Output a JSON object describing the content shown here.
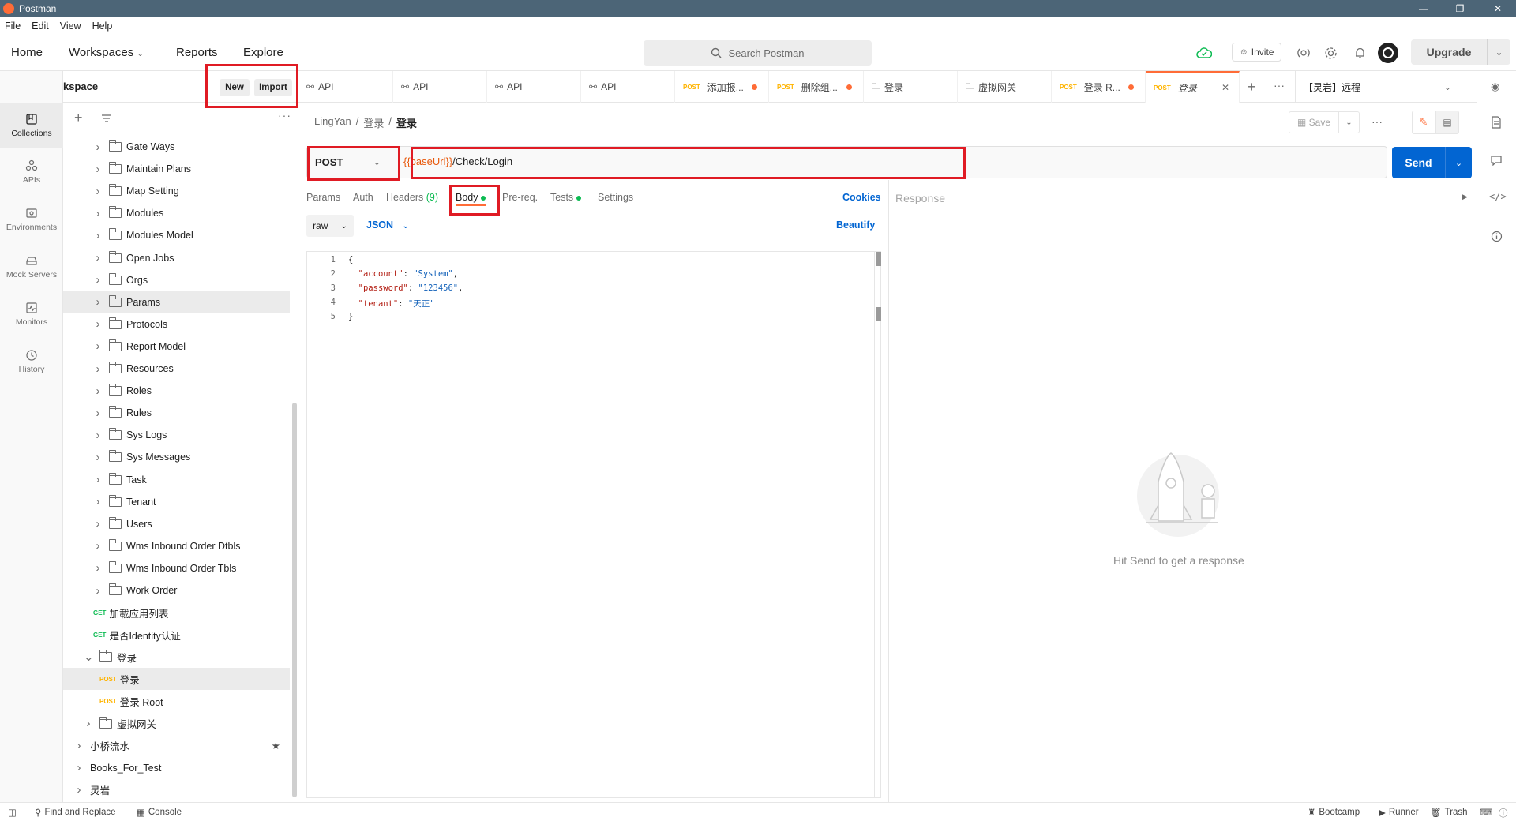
{
  "app": {
    "title": "Postman"
  },
  "menu": [
    "File",
    "Edit",
    "View",
    "Help"
  ],
  "topnav": {
    "home": "Home",
    "workspaces": "Workspaces",
    "reports": "Reports",
    "explore": "Explore",
    "search_placeholder": "Search Postman",
    "invite": "Invite",
    "upgrade": "Upgrade"
  },
  "workspace": {
    "name": "My Workspace",
    "new": "New",
    "import": "Import"
  },
  "rail": [
    "Collections",
    "APIs",
    "Environments",
    "Mock Servers",
    "Monitors",
    "History"
  ],
  "tree": [
    {
      "type": "folder",
      "label": "Gate Ways",
      "depth": 1
    },
    {
      "type": "folder",
      "label": "Maintain Plans",
      "depth": 1
    },
    {
      "type": "folder",
      "label": "Map Setting",
      "depth": 1
    },
    {
      "type": "folder",
      "label": "Modules",
      "depth": 1
    },
    {
      "type": "folder",
      "label": "Modules Model",
      "depth": 1
    },
    {
      "type": "folder",
      "label": "Open Jobs",
      "depth": 1
    },
    {
      "type": "folder",
      "label": "Orgs",
      "depth": 1
    },
    {
      "type": "folder",
      "label": "Params",
      "depth": 1
    },
    {
      "type": "folder",
      "label": "Protocols",
      "depth": 1
    },
    {
      "type": "folder",
      "label": "Report Model",
      "depth": 1
    },
    {
      "type": "folder",
      "label": "Resources",
      "depth": 1
    },
    {
      "type": "folder",
      "label": "Roles",
      "depth": 1
    },
    {
      "type": "folder",
      "label": "Rules",
      "depth": 1
    },
    {
      "type": "folder",
      "label": "Sys Logs",
      "depth": 1
    },
    {
      "type": "folder",
      "label": "Sys Messages",
      "depth": 1
    },
    {
      "type": "folder",
      "label": "Task",
      "depth": 1
    },
    {
      "type": "folder",
      "label": "Tenant",
      "depth": 1
    },
    {
      "type": "folder",
      "label": "Users",
      "depth": 1
    },
    {
      "type": "folder",
      "label": "Wms Inbound Order Dtbls",
      "depth": 1
    },
    {
      "type": "folder",
      "label": "Wms Inbound Order Tbls",
      "depth": 1
    },
    {
      "type": "folder",
      "label": "Work Order",
      "depth": 1
    },
    {
      "type": "request",
      "method": "GET",
      "label": "加載应用列表",
      "depth": 1
    },
    {
      "type": "request",
      "method": "GET",
      "label": "是否Identity认证",
      "depth": 1
    },
    {
      "type": "folder-open",
      "label": "登录",
      "depth": 0
    },
    {
      "type": "request",
      "method": "POST",
      "label": "登录",
      "depth": 2
    },
    {
      "type": "request",
      "method": "POST",
      "label": "登录 Root",
      "depth": 2
    },
    {
      "type": "folder",
      "label": "虚拟网关",
      "depth": 0
    },
    {
      "type": "collection",
      "label": "小桥流水",
      "depth": -1
    },
    {
      "type": "collection",
      "label": "Books_For_Test",
      "depth": -1
    },
    {
      "type": "collection",
      "label": "灵岩",
      "depth": -1
    }
  ],
  "tabs": [
    {
      "method": "",
      "label": "API",
      "dot": false
    },
    {
      "method": "",
      "label": "API",
      "dot": false
    },
    {
      "method": "",
      "label": "API",
      "dot": false
    },
    {
      "method": "",
      "label": "API",
      "dot": false
    },
    {
      "method": "POST",
      "label": "添加报...",
      "dot": true
    },
    {
      "method": "POST",
      "label": "删除组...",
      "dot": true
    },
    {
      "method": "",
      "label": "登录",
      "dot": false
    },
    {
      "method": "",
      "label": "虚拟网关",
      "dot": false
    },
    {
      "method": "POST",
      "label": "登录 R...",
      "dot": true
    },
    {
      "method": "POST",
      "label": "登录",
      "dot": false
    }
  ],
  "environment": "【灵岩】远程",
  "breadcrumb": [
    "LingYan",
    "/",
    "登录",
    "/",
    "登录"
  ],
  "save": "Save",
  "request": {
    "method": "POST",
    "url_var": "{{baseUrl}}",
    "url_path": "/Check/Login",
    "send": "Send"
  },
  "req_tabs": {
    "params": "Params",
    "auth": "Auth",
    "headers": "Headers",
    "headers_count": "(9)",
    "body": "Body",
    "prereq": "Pre-req.",
    "tests": "Tests",
    "settings": "Settings",
    "cookies": "Cookies"
  },
  "body": {
    "mode": "raw",
    "format": "JSON",
    "beautify": "Beautify"
  },
  "code_lines": [
    {
      "n": "1",
      "parts": [
        [
          "p",
          "{"
        ]
      ]
    },
    {
      "n": "2",
      "parts": [
        [
          "p",
          "  "
        ],
        [
          "k",
          "\"account\""
        ],
        [
          "p",
          ": "
        ],
        [
          "s",
          "\"System\""
        ],
        [
          "p",
          ","
        ]
      ]
    },
    {
      "n": "3",
      "parts": [
        [
          "p",
          "  "
        ],
        [
          "k",
          "\"password\""
        ],
        [
          "p",
          ": "
        ],
        [
          "s",
          "\"123456\""
        ],
        [
          "p",
          ","
        ]
      ]
    },
    {
      "n": "4",
      "parts": [
        [
          "p",
          "  "
        ],
        [
          "k",
          "\"tenant\""
        ],
        [
          "p",
          ": "
        ],
        [
          "s",
          "\"天正\""
        ]
      ]
    },
    {
      "n": "5",
      "parts": [
        [
          "p",
          "}"
        ]
      ]
    }
  ],
  "response": {
    "title": "Response",
    "hint": "Hit Send to get a response"
  },
  "statusbar": {
    "find_replace": "Find and Replace",
    "console": "Console",
    "bootcamp": "Bootcamp",
    "runner": "Runner",
    "trash": "Trash"
  },
  "colors": {
    "accent": "#ff6c37",
    "send": "#0265d2",
    "highlight": "#e01b24"
  }
}
